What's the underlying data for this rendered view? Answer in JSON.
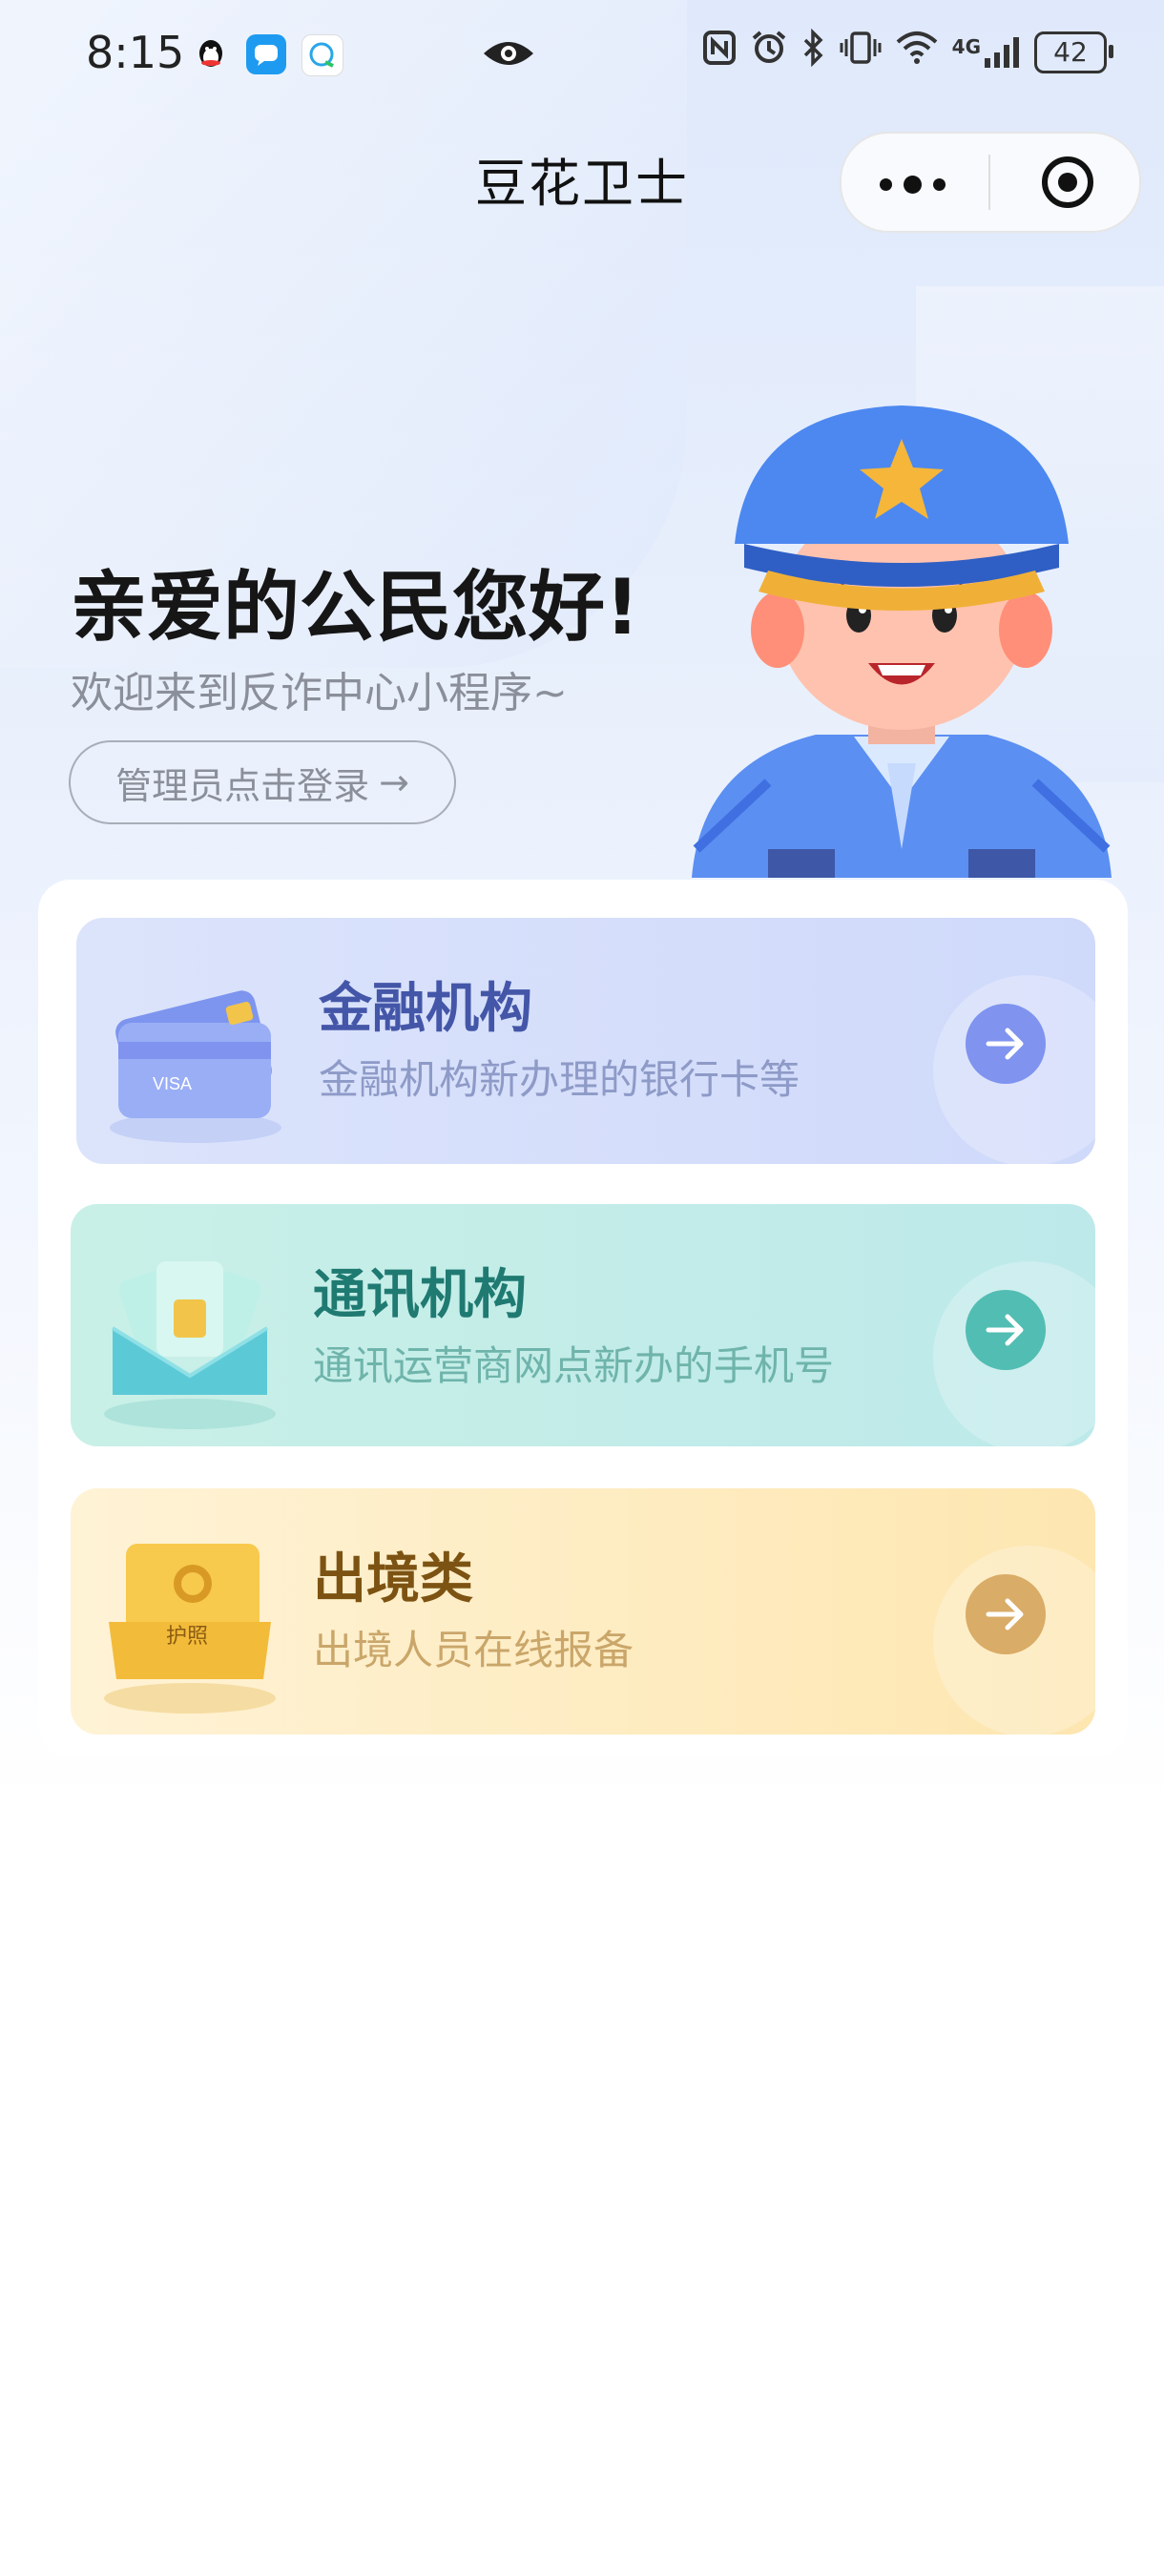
{
  "status_bar": {
    "time": "8:15",
    "network": "4G",
    "battery": "42",
    "icons": [
      "qq-icon",
      "message-icon",
      "chat-icon",
      "eye-icon",
      "nfc-icon",
      "alarm-icon",
      "bluetooth-icon",
      "vibrate-icon",
      "wifi-icon",
      "signal-icon",
      "battery-icon"
    ]
  },
  "nav": {
    "title": "豆花卫士"
  },
  "hero": {
    "greeting": "亲爱的公民您好!",
    "subtitle": "欢迎来到反诈中心小程序~",
    "login_button": "管理员点击登录",
    "login_arrow": "→"
  },
  "cards": [
    {
      "title": "金融机构",
      "desc": "金融机构新办理的银行卡等",
      "icon": "bank-card-icon",
      "color": "#4456a8"
    },
    {
      "title": "通讯机构",
      "desc": "通讯运营商网点新办的手机号",
      "icon": "sim-card-icon",
      "color": "#1f7a72"
    },
    {
      "title": "出境类",
      "desc": "出境人员在线报备",
      "icon": "passport-icon",
      "color": "#7c5312",
      "icon_text": "护照"
    }
  ]
}
